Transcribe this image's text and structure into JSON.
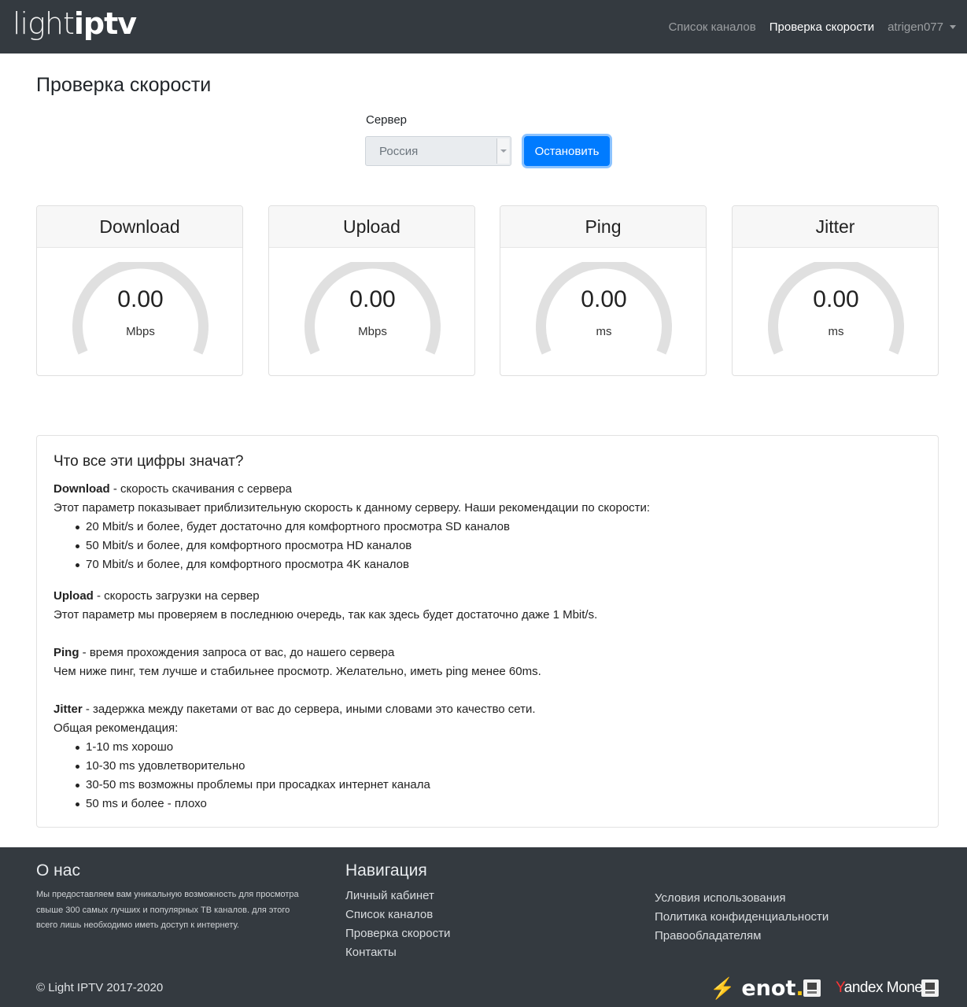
{
  "brand": {
    "light": "light",
    "iptv": "iptv"
  },
  "nav": {
    "channels": "Список каналов",
    "speedtest": "Проверка скорости",
    "user": "atrigen077"
  },
  "page": {
    "title": "Проверка скорости",
    "server_label": "Сервер",
    "server_value": "Россия",
    "stop_button": "Остановить"
  },
  "gauges": [
    {
      "title": "Download",
      "value": "0.00",
      "unit": "Mbps",
      "level": 0
    },
    {
      "title": "Upload",
      "value": "0.00",
      "unit": "Mbps",
      "level": 0
    },
    {
      "title": "Ping",
      "value": "0.00",
      "unit": "ms",
      "level": 0
    },
    {
      "title": "Jitter",
      "value": "0.00",
      "unit": "ms",
      "level": 0
    }
  ],
  "info": {
    "heading": "Что все эти цифры значат?",
    "download": {
      "term": "Download",
      "desc": " - скорость скачивания с сервера",
      "text": "Этот параметр показывает приблизительную скорость к данному серверу. Наши рекомендации по скорости:",
      "items": [
        "20 Mbit/s и более, будет достаточно для комфортного просмотра SD каналов",
        "50 Mbit/s и более, для комфортного просмотра HD каналов",
        "70 Mbit/s и более, для комфортного просмотра 4K каналов"
      ]
    },
    "upload": {
      "term": "Upload",
      "desc": " - скорость загрузки на сервер",
      "text": "Этот параметр мы проверяем в последнюю очередь, так как здесь будет достаточно даже 1 Mbit/s."
    },
    "ping": {
      "term": "Ping",
      "desc": " - время прохождения запроса от вас, до нашего сервера",
      "text": "Чем ниже пинг, тем лучше и стабильнее просмотр. Желательно, иметь ping менее 60ms."
    },
    "jitter": {
      "term": "Jitter",
      "desc": " - задержка между пакетами от вас до сервера, иными словами это качество сети.",
      "text": "Общая рекомендация:",
      "items": [
        "1-10 ms хорошо",
        "10-30 ms удовлетворительно",
        "30-50 ms возможны проблемы при просадках интернет канала",
        "50 ms и более - плохо"
      ]
    }
  },
  "footer": {
    "about_title": "О нас",
    "about_text": "Мы предоставляем вам уникальную возможность для просмотра свыше 300 самых лучших и популярных ТВ каналов. для этого всего лишь необходимо иметь доступ к интернету.",
    "nav_title": "Навигация",
    "nav_links": [
      "Личный кабинет",
      "Список каналов",
      "Проверка скорости",
      "Контакты"
    ],
    "legal_links": [
      "Условия использования",
      "Политика конфиденциальности",
      "Правообладателям"
    ],
    "copyright": "© Light IPTV 2017-2020",
    "payments": {
      "enot": "enot",
      "enot_dot": ".",
      "yandex_y": "Y",
      "yandex_rest": "andex Money"
    }
  }
}
